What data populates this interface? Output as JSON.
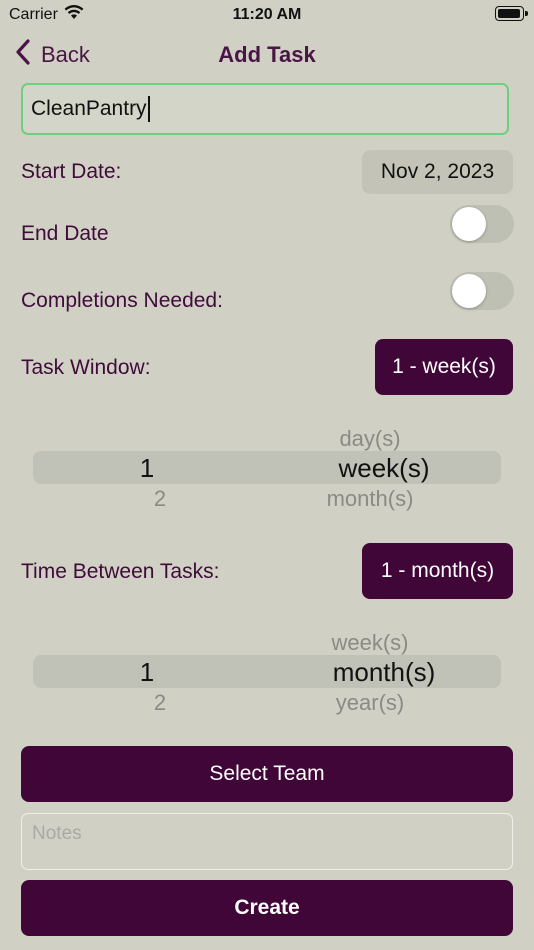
{
  "status_bar": {
    "carrier": "Carrier",
    "time": "11:20 AM"
  },
  "nav": {
    "back_label": "Back",
    "title": "Add Task"
  },
  "task_name": {
    "value": "CleanPantry"
  },
  "start_date": {
    "label": "Start Date:",
    "value": "Nov 2, 2023"
  },
  "end_date": {
    "label": "End Date",
    "enabled": false
  },
  "completions": {
    "label": "Completions Needed:",
    "enabled": false
  },
  "task_window": {
    "label": "Task Window:",
    "button": "1 - week(s)",
    "picker": {
      "number_selected": "1",
      "number_below": "2",
      "unit_above": "day(s)",
      "unit_selected": "week(s)",
      "unit_below": "month(s)"
    }
  },
  "time_between": {
    "label": "Time Between Tasks:",
    "button": "1 - month(s)",
    "picker": {
      "number_selected": "1",
      "number_below": "2",
      "unit_above": "week(s)",
      "unit_selected": "month(s)",
      "unit_below": "year(s)"
    }
  },
  "select_team_label": "Select Team",
  "notes": {
    "placeholder": "Notes"
  },
  "create_label": "Create",
  "colors": {
    "accent": "#400637",
    "background": "#d0d1c4",
    "input_border": "#6fce7f"
  }
}
